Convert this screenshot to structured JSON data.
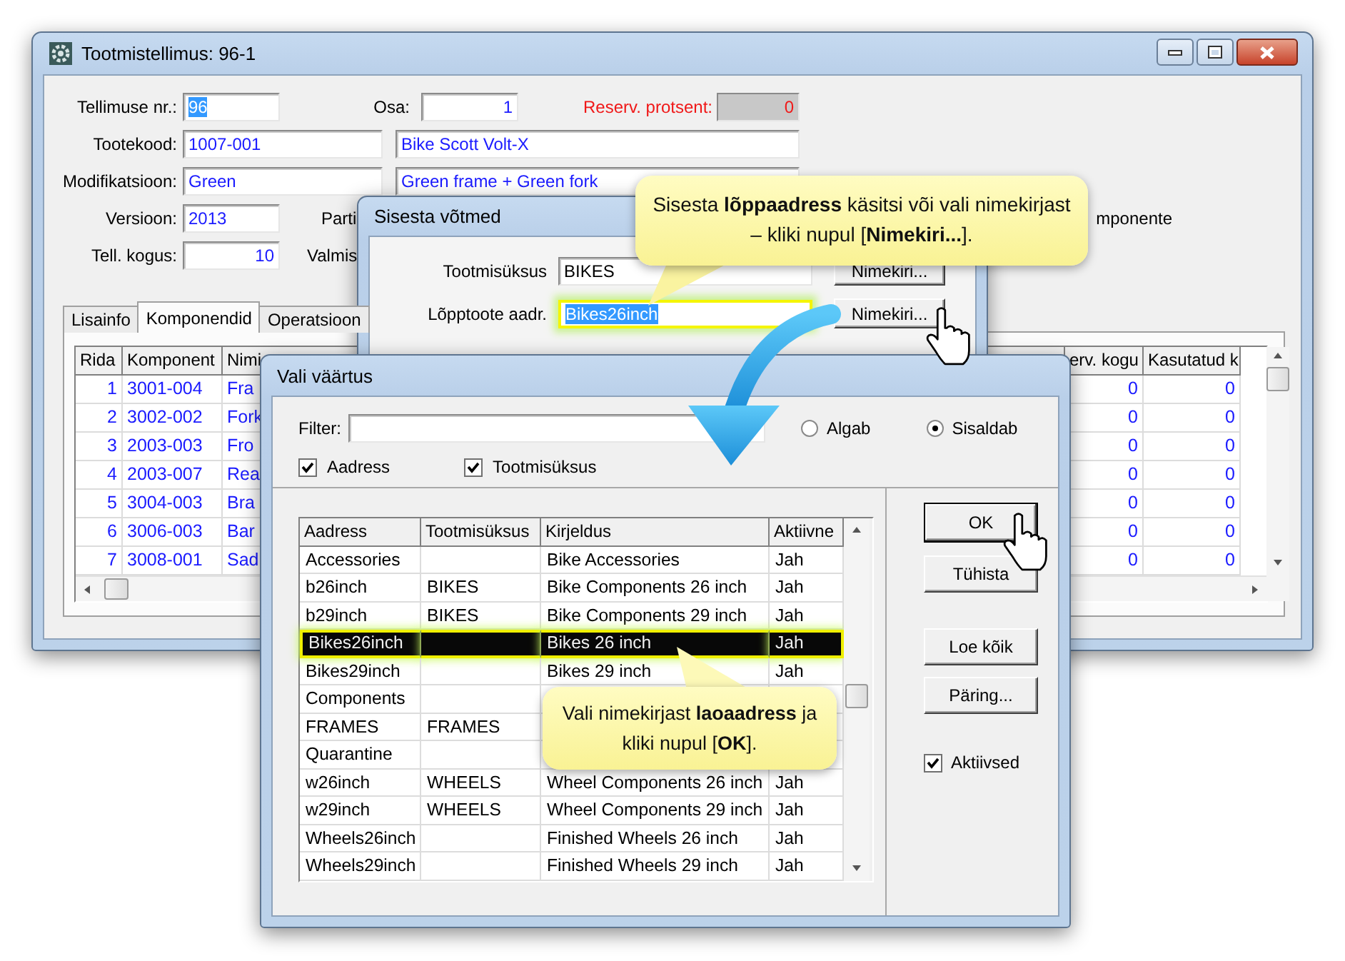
{
  "main_window": {
    "title": "Tootmistellimus: 96-1",
    "order_no": {
      "label": "Tellimuse nr.:",
      "value": "96",
      "text_selected": true
    },
    "part": {
      "label": "Osa:",
      "value": "1"
    },
    "reserve_percent": {
      "label": "Reserv. protsent:",
      "value": "0"
    },
    "product_code": {
      "label": "Tootekood:",
      "value": "1007-001",
      "description": "Bike Scott Volt-X"
    },
    "modification": {
      "label": "Modifikatsioon:",
      "value": "Green",
      "description": "Green frame + Green fork"
    },
    "version": {
      "label": "Versioon:",
      "value": "2013"
    },
    "batch_label": "Parti",
    "quantity": {
      "label": "Tell. kogus:",
      "value": "10"
    },
    "finished_label": "Valmis",
    "side_label": "mponente",
    "tabs": [
      {
        "label": "Lisainfo",
        "selected": false
      },
      {
        "label": "Komponendid",
        "selected": true
      },
      {
        "label": "Operatsioon",
        "selected": false
      }
    ],
    "table": {
      "columns": [
        "Rida",
        "Komponent",
        "Nimi",
        "erv. kogu",
        "Kasutatud k"
      ],
      "rows": [
        {
          "rida": "1",
          "komponent": "3001-004",
          "nimi": "Fra",
          "reserved": "0",
          "used": "0"
        },
        {
          "rida": "2",
          "komponent": "3002-002",
          "nimi": "Fork",
          "reserved": "0",
          "used": "0"
        },
        {
          "rida": "3",
          "komponent": "2003-003",
          "nimi": "Fro",
          "reserved": "0",
          "used": "0"
        },
        {
          "rida": "4",
          "komponent": "2003-007",
          "nimi": "Rea",
          "reserved": "0",
          "used": "0"
        },
        {
          "rida": "5",
          "komponent": "3004-003",
          "nimi": "Bra",
          "reserved": "0",
          "used": "0"
        },
        {
          "rida": "6",
          "komponent": "3006-003",
          "nimi": "Bar",
          "reserved": "0",
          "used": "0"
        },
        {
          "rida": "7",
          "komponent": "3008-001",
          "nimi": "Sad",
          "reserved": "0",
          "used": "0"
        }
      ]
    }
  },
  "keys_dialog": {
    "title": "Sisesta võtmed",
    "fields": [
      {
        "label": "Tootmisüksus",
        "value": "BIKES",
        "highlighted": false,
        "text_selected": false,
        "button": "Nimekiri..."
      },
      {
        "label": "Lõpptoote aadr.",
        "value": "Bikes26inch",
        "highlighted": true,
        "text_selected": true,
        "button": "Nimekiri..."
      }
    ]
  },
  "value_dialog": {
    "title": "Vali väärtus",
    "filter_label": "Filter:",
    "match_options": [
      {
        "label": "Algab",
        "selected": false
      },
      {
        "label": "Sisaldab",
        "selected": true
      }
    ],
    "search_in": [
      {
        "label": "Aadress",
        "checked": true
      },
      {
        "label": "Tootmisüksus",
        "checked": true
      }
    ],
    "table": {
      "columns": [
        "Aadress",
        "Tootmisüksus",
        "Kirjeldus",
        "Aktiivne"
      ],
      "rows": [
        {
          "aadress": "Accessories",
          "kirjeldus": "Bike Accessories",
          "aktiivne": "Jah",
          "selected": false
        },
        {
          "aadress": "b26inch",
          "tootmisuksus": "BIKES",
          "kirjeldus": "Bike Components 26 inch",
          "aktiivne": "Jah",
          "selected": false
        },
        {
          "aadress": "b29inch",
          "tootmisuksus": "BIKES",
          "kirjeldus": "Bike Components 29 inch",
          "aktiivne": "Jah",
          "selected": false
        },
        {
          "aadress": "Bikes26inch",
          "kirjeldus": "Bikes 26 inch",
          "aktiivne": "Jah",
          "selected": true
        },
        {
          "aadress": "Bikes29inch",
          "kirjeldus": "Bikes 29 inch",
          "aktiivne": "Jah",
          "selected": false
        },
        {
          "aadress": "Components",
          "selected": false
        },
        {
          "aadress": "FRAMES",
          "tootmisuksus": "FRAMES",
          "selected": false
        },
        {
          "aadress": "Quarantine",
          "selected": false
        },
        {
          "aadress": "w26inch",
          "tootmisuksus": "WHEELS",
          "kirjeldus": "Wheel Components 26 inch",
          "aktiivne": "Jah",
          "selected": false
        },
        {
          "aadress": "w29inch",
          "tootmisuksus": "WHEELS",
          "kirjeldus": "Wheel Components 29 inch",
          "aktiivne": "Jah",
          "selected": false
        },
        {
          "aadress": "Wheels26inch",
          "kirjeldus": "Finished Wheels 26 inch",
          "aktiivne": "Jah",
          "selected": false
        },
        {
          "aadress": "Wheels29inch",
          "kirjeldus": "Finished Wheels 29 inch",
          "aktiivne": "Jah",
          "selected": false
        }
      ]
    },
    "buttons": [
      "OK",
      "Tühista",
      "Loe kõik",
      "Päring..."
    ],
    "active_only": {
      "label": "Aktiivsed",
      "checked": true
    }
  },
  "callouts": [
    {
      "text": "Sisesta **lõppaadress** käsitsi või vali nimekirjast – kliki nupul [**Nimekiri...**]."
    },
    {
      "text": "Vali nimekirjast **laoaadress** ja kliki nupul [**OK**]."
    }
  ]
}
